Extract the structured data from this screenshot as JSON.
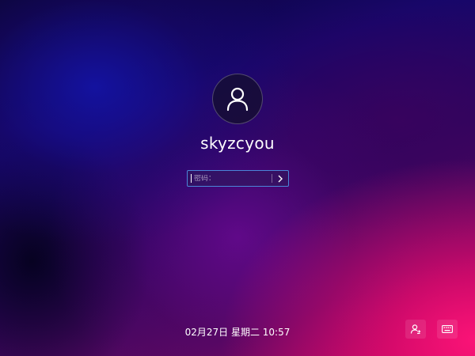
{
  "user": {
    "name": "skyzcyou",
    "avatar_icon": "user-avatar-icon"
  },
  "password": {
    "placeholder": "密码：",
    "value": "",
    "submit_icon": "chevron-right-icon"
  },
  "footer": {
    "datetime": "02月27日 星期二 10:57"
  },
  "actions": [
    {
      "name": "switch-user",
      "icon": "user-switch-icon"
    },
    {
      "name": "keyboard-layout",
      "icon": "keyboard-icon"
    }
  ],
  "colors": {
    "input_border": "#4a86d8",
    "text": "#ffffff"
  }
}
